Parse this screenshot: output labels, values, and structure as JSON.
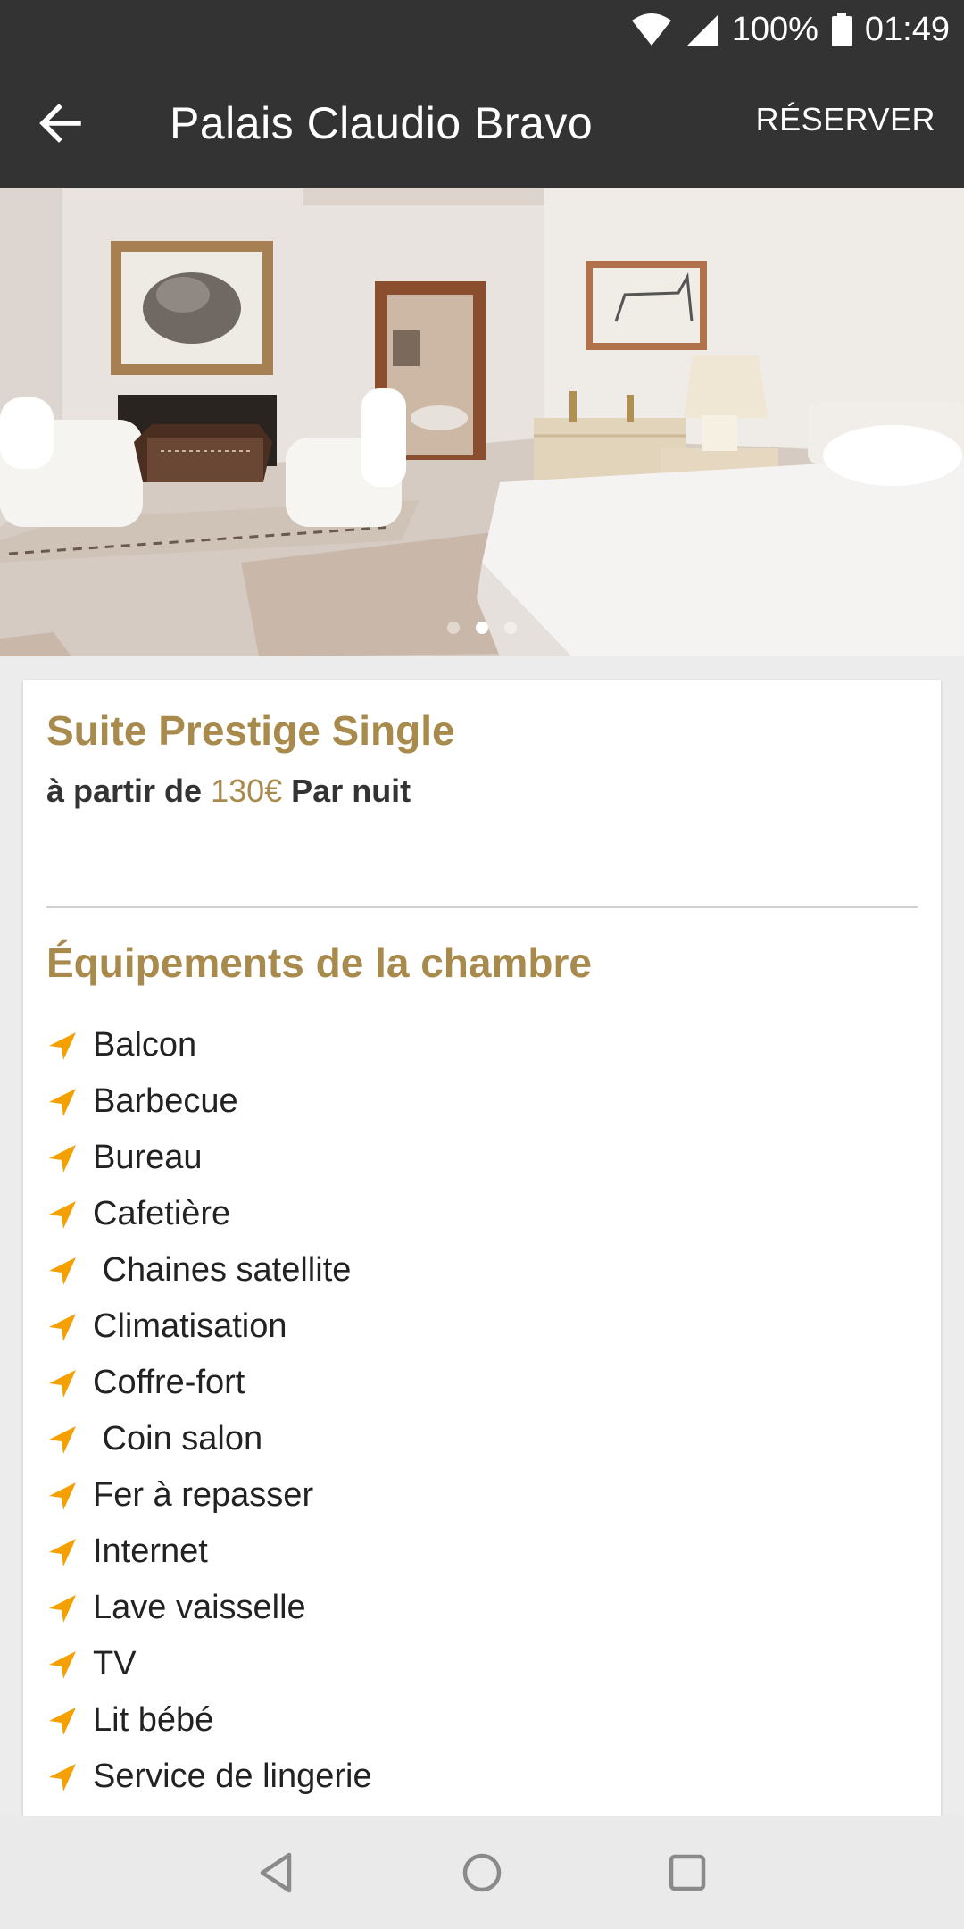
{
  "status_bar": {
    "battery_level": "100%",
    "time": "01:49"
  },
  "app_bar": {
    "title": "Palais Claudio Bravo",
    "reserve_label": "RÉSERVER"
  },
  "hero": {
    "slide_count": 3,
    "active_slide": 1
  },
  "room": {
    "name": "Suite Prestige Single",
    "price_prefix": "à partir de",
    "price": "130€",
    "price_suffix": "Par nuit"
  },
  "amenities_section": {
    "title": "Équipements de la chambre",
    "items": [
      "Balcon",
      "Barbecue",
      "Bureau",
      "Cafetière",
      " Chaines satellite",
      "Climatisation",
      "Coffre-fort",
      " Coin salon",
      "Fer à repasser",
      "Internet",
      "Lave vaisselle",
      "TV",
      "Lit bébé",
      "Service de lingerie"
    ]
  },
  "colors": {
    "accent": "#a88b4c",
    "icon": "#f4a000",
    "bar": "#333333"
  }
}
